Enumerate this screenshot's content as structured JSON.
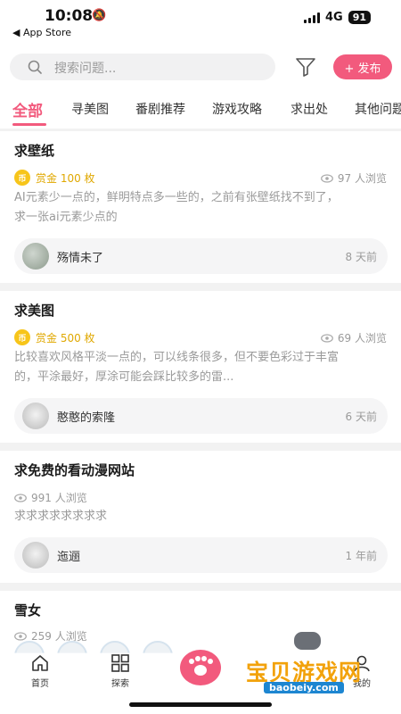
{
  "status": {
    "time": "10:08",
    "back_label": "◀ App Store",
    "network": "4G",
    "battery": "91"
  },
  "search": {
    "placeholder": "搜索问题..."
  },
  "publish_label": "+ 发布",
  "tabs": [
    "全部",
    "寻美图",
    "番剧推荐",
    "游戏攻略",
    "求出处",
    "其他问题"
  ],
  "posts": [
    {
      "title": "求壁纸",
      "bounty": "赏金 100 枚",
      "views": "97 人浏览",
      "desc_line1": "AI元素少一点的，鲜明特点多一些的，之前有张壁纸找不到了，",
      "desc_line2": "求一张ai元素少点的",
      "user": "殇情未了",
      "ago": "8 天前"
    },
    {
      "title": "求美图",
      "bounty": "赏金 500 枚",
      "views": "69 人浏览",
      "desc_line1": "比较喜欢风格平淡一点的，可以线条很多，但不要色彩过于丰富",
      "desc_line2": "的，平涂最好，厚涂可能会踩比较多的雷...",
      "user": "憨憨的索隆",
      "ago": "6 天前"
    },
    {
      "title": "求免费的看动漫网站",
      "views": "991 人浏览",
      "desc_line1": "求求求求求求求求",
      "user": "迤逦",
      "ago": "1 年前"
    },
    {
      "title": "雪女",
      "views": "259 人浏览"
    }
  ],
  "coin_label": "币",
  "bottom_nav": {
    "home": "首页",
    "explore": "探索",
    "mine": "我的"
  },
  "watermark": {
    "text": "宝贝游戏网",
    "url": "baobeiy.com"
  },
  "colors": {
    "accent": "#f25a7d",
    "bounty": "#e0a800"
  }
}
